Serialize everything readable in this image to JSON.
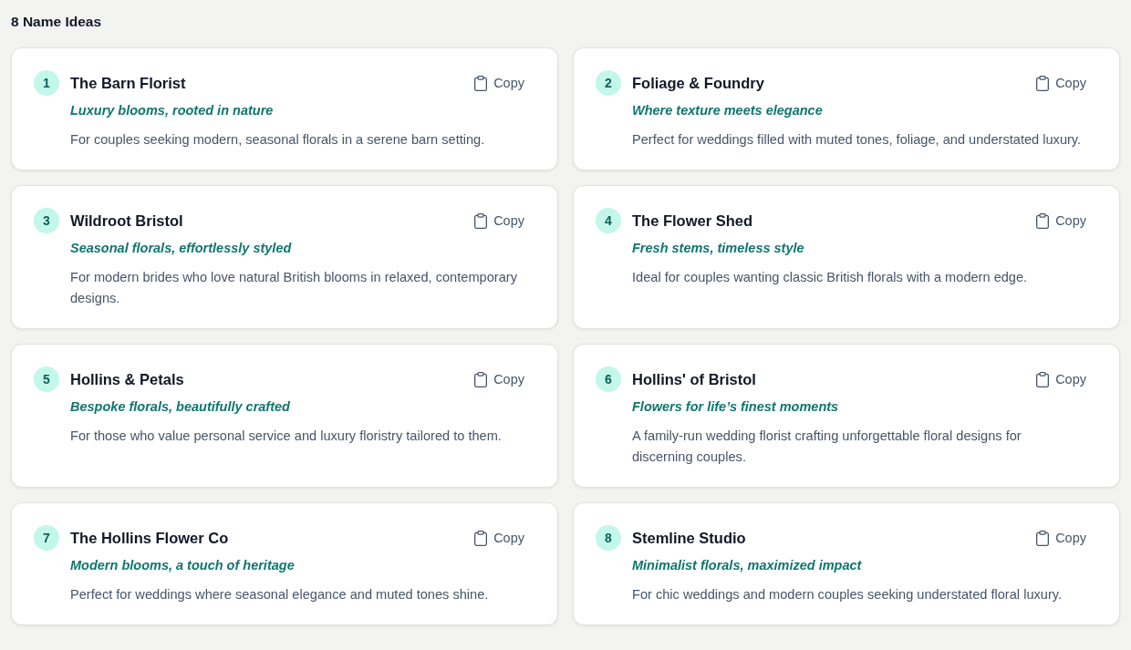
{
  "heading": "8 Name Ideas",
  "ideas": [
    {
      "number": "1",
      "name": "The Barn Florist",
      "tagline": "Luxury blooms, rooted in nature",
      "description": "For couples seeking modern, seasonal florals in a serene barn setting.",
      "copy_label": "Copy"
    },
    {
      "number": "2",
      "name": "Foliage & Foundry",
      "tagline": "Where texture meets elegance",
      "description": "Perfect for weddings filled with muted tones, foliage, and understated luxury.",
      "copy_label": "Copy"
    },
    {
      "number": "3",
      "name": "Wildroot Bristol",
      "tagline": "Seasonal florals, effortlessly styled",
      "description": "For modern brides who love natural British blooms in relaxed, contemporary designs.",
      "copy_label": "Copy"
    },
    {
      "number": "4",
      "name": "The Flower Shed",
      "tagline": "Fresh stems, timeless style",
      "description": "Ideal for couples wanting classic British florals with a modern edge.",
      "copy_label": "Copy"
    },
    {
      "number": "5",
      "name": "Hollins & Petals",
      "tagline": "Bespoke florals, beautifully crafted",
      "description": "For those who value personal service and luxury floristry tailored to them.",
      "copy_label": "Copy"
    },
    {
      "number": "6",
      "name": "Hollins' of Bristol",
      "tagline": "Flowers for life’s finest moments",
      "description": "A family-run wedding florist crafting unforgettable floral designs for discerning couples.",
      "copy_label": "Copy"
    },
    {
      "number": "7",
      "name": "The Hollins Flower Co",
      "tagline": "Modern blooms, a touch of heritage",
      "description": "Perfect for weddings where seasonal elegance and muted tones shine.",
      "copy_label": "Copy"
    },
    {
      "number": "8",
      "name": "Stemline Studio",
      "tagline": "Minimalist florals, maximized impact",
      "description": "For chic weddings and modern couples seeking understated floral luxury.",
      "copy_label": "Copy"
    }
  ]
}
